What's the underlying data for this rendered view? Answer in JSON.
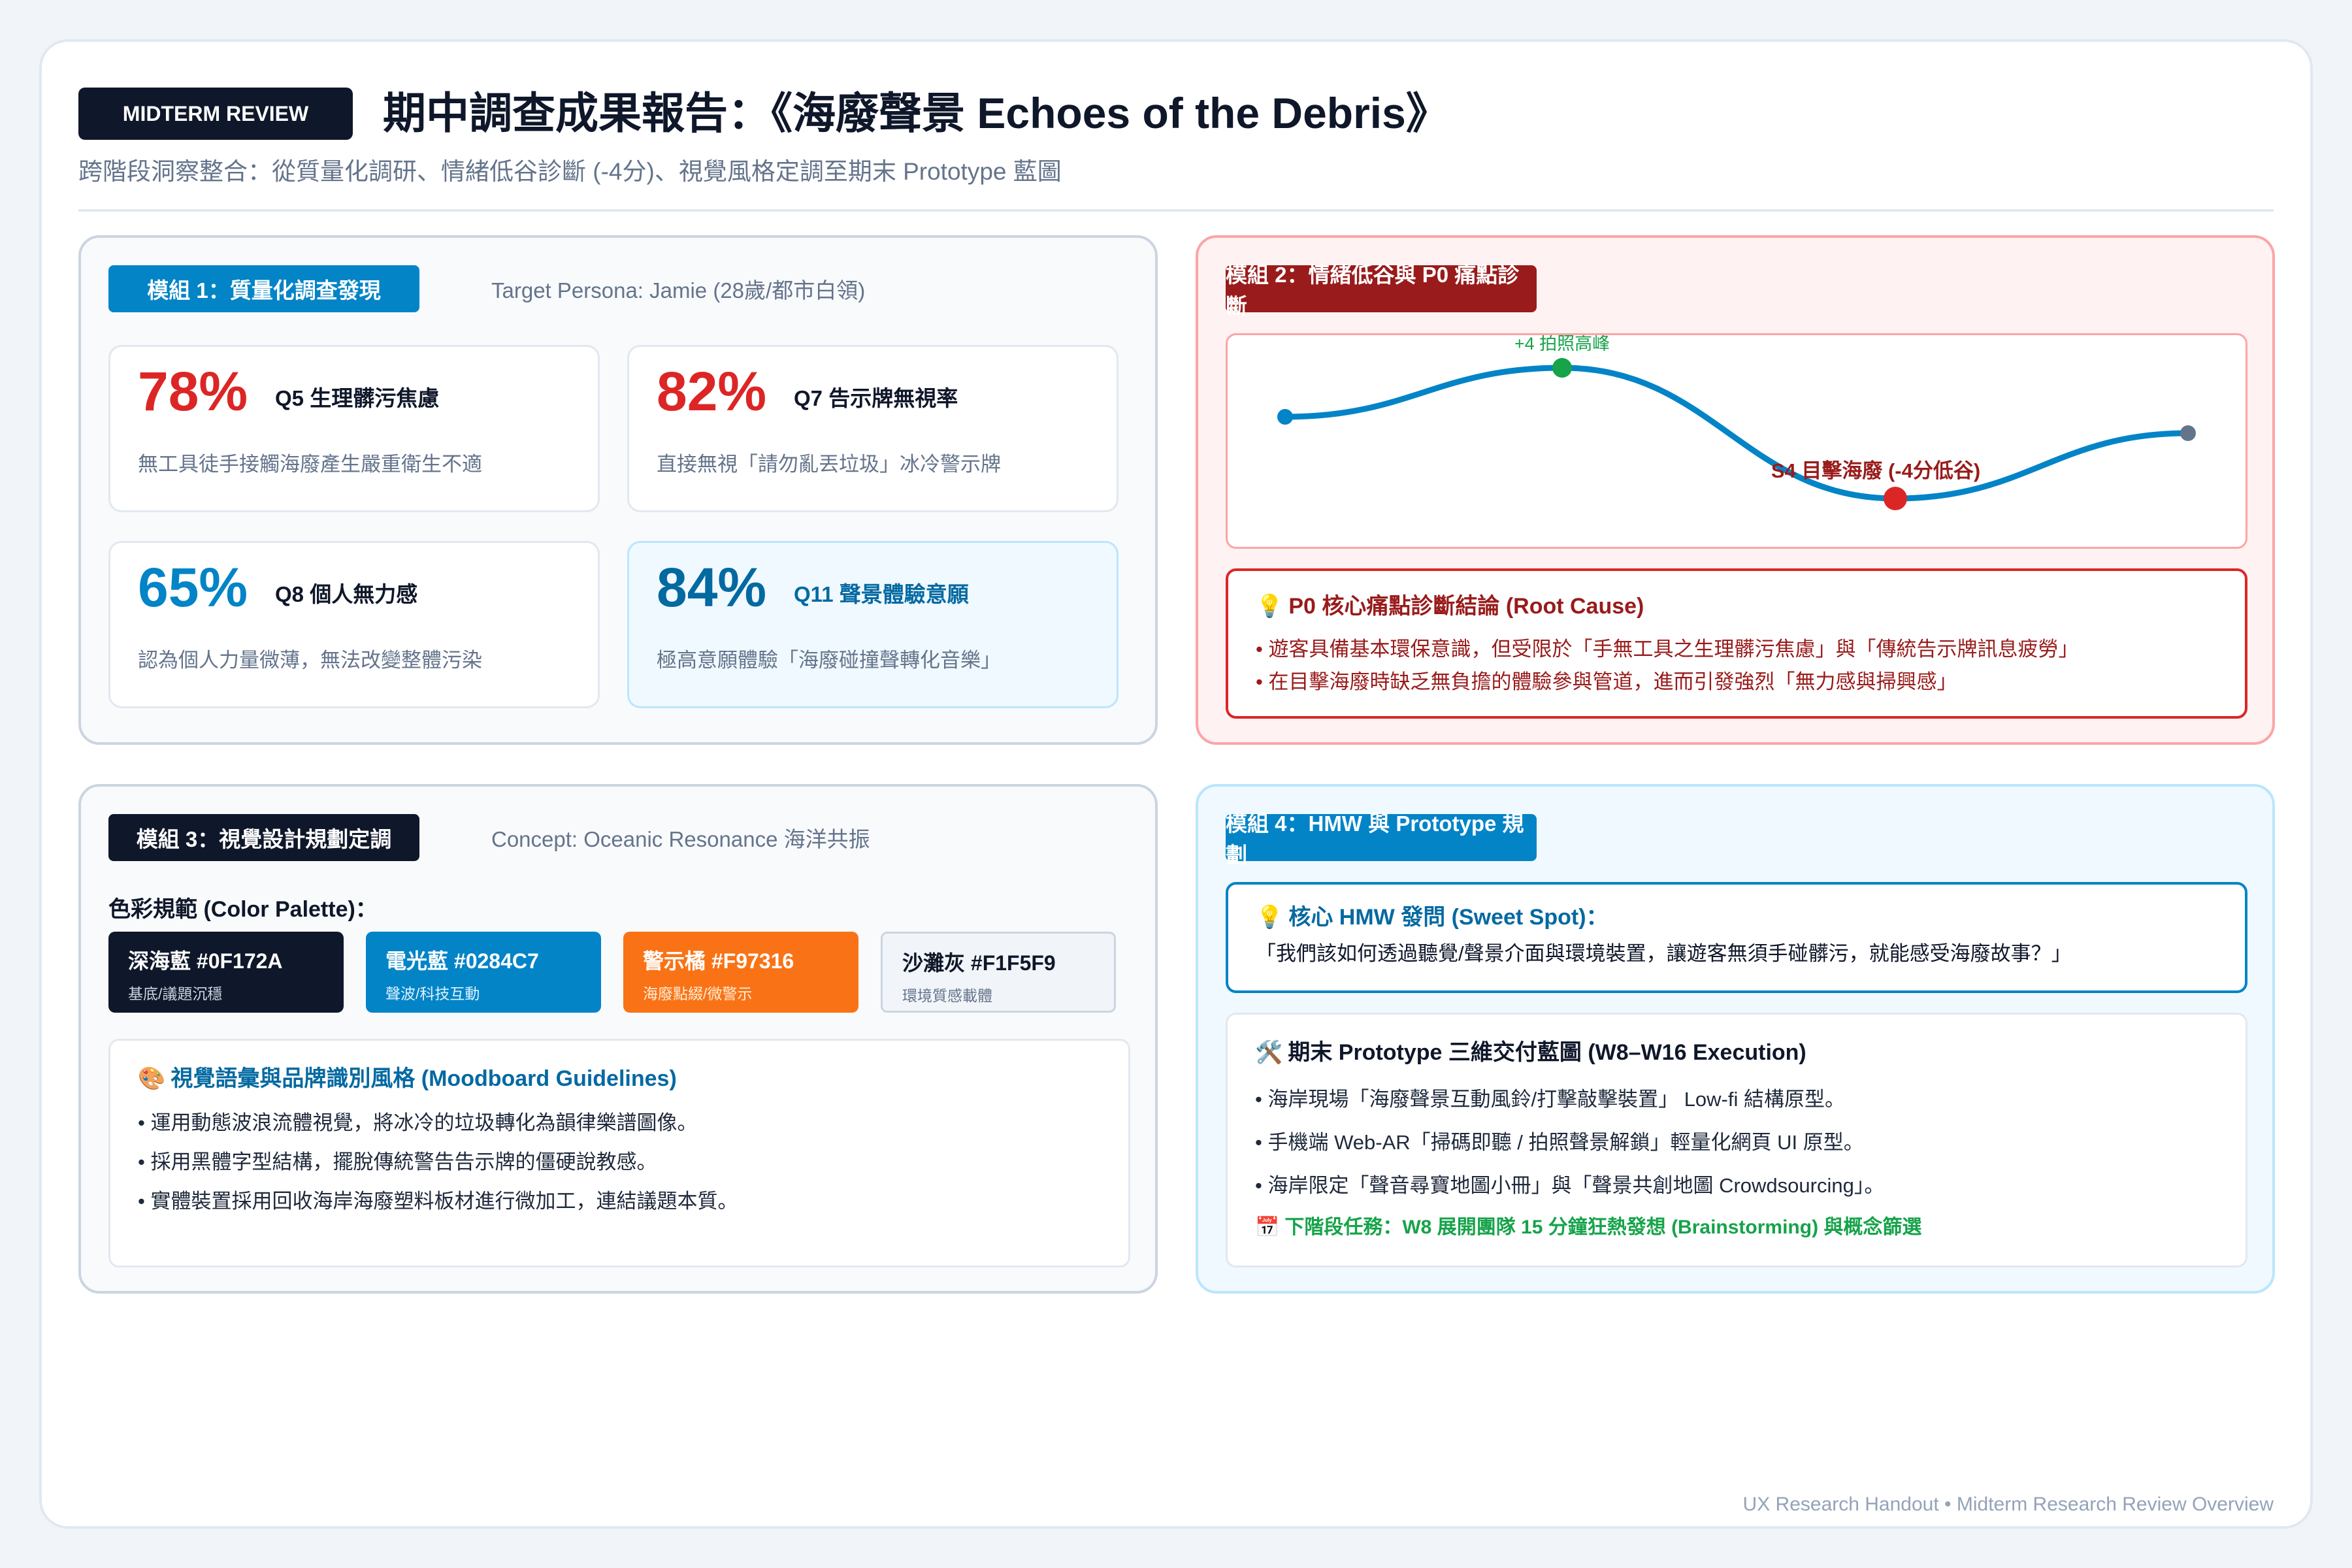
{
  "header": {
    "badge": "MIDTERM REVIEW",
    "title": "期中調查成果報告：《海廢聲景 Echoes of the Debris》",
    "subtitle": "跨階段洞察整合：從質量化調研、情緒低谷診斷 (-4分)、視覺風格定調至期末 Prototype 藍圖"
  },
  "module1": {
    "badge": "模組 1：質量化調查發現",
    "subtitle": "Target Persona: Jamie (28歲/都市白領)",
    "stats": [
      {
        "value": "78%",
        "label": "Q5 生理髒污焦慮",
        "desc": "無工具徒手接觸海廢產生嚴重衛生不適"
      },
      {
        "value": "82%",
        "label": "Q7 告示牌無視率",
        "desc": "直接無視「請勿亂丟垃圾」冰冷警示牌"
      },
      {
        "value": "65%",
        "label": "Q8 個人無力感",
        "desc": "認為個人力量微薄，無法改變整體污染"
      },
      {
        "value": "84%",
        "label": "Q11 聲景體驗意願",
        "desc": "極高意願體驗「海廢碰撞聲轉化音樂」"
      }
    ]
  },
  "module2": {
    "badge": "模組 2：情緒低谷與 P0 痛點診斷",
    "chart_data": {
      "type": "line",
      "points": [
        {
          "stage": 1,
          "score": 1
        },
        {
          "stage": 2,
          "score": 4
        },
        {
          "stage": 3,
          "score": -4
        },
        {
          "stage": 4,
          "score": 0
        }
      ],
      "annotations": {
        "peak": "+4 拍照高峰",
        "low": "S4 目擊海廢 (-4分低谷)"
      }
    },
    "root_title": "P0 核心痛點診斷結論 (Root Cause)",
    "root_bullets": [
      "• 遊客具備基本環保意識，但受限於「手無工具之生理髒污焦慮」與「傳統告示牌訊息疲勞」",
      "• 在目擊海廢時缺乏無負擔的體驗參與管道，進而引發強烈「無力感與掃興感」"
    ]
  },
  "module3": {
    "badge": "模組 3：視覺設計規劃定調",
    "subtitle": "Concept: Oceanic Resonance 海洋共振",
    "palette_title": "色彩規範 (Color Palette)：",
    "swatches": [
      {
        "name": "深海藍 #0F172A",
        "desc": "基底/議題沉穩",
        "color": "#0F172A"
      },
      {
        "name": "電光藍 #0284C7",
        "desc": "聲波/科技互動",
        "color": "#0284C7"
      },
      {
        "name": "警示橘 #F97316",
        "desc": "海廢點綴/微警示",
        "color": "#F97316"
      },
      {
        "name": "沙灘灰 #F1F5F9",
        "desc": "環境質感載體",
        "color": "#F1F5F9"
      }
    ],
    "mood_title": "視覺語彙與品牌識別風格 (Moodboard Guidelines)",
    "mood_bullets": [
      "• 運用動態波浪流體視覺，將冰冷的垃圾轉化為韻律樂譜圖像。",
      "• 採用黑體字型結構，擺脫傳統警告告示牌的僵硬說教感。",
      "• 實體裝置採用回收海岸海廢塑料板材進行微加工，連結議題本質。"
    ]
  },
  "module4": {
    "badge": "模組 4：HMW 與 Prototype 規劃",
    "hmw_title": "核心 HMW 發問 (Sweet Spot)：",
    "hmw_quote": "「我們該如何透過聽覺/聲景介面與環境裝置，讓遊客無須手碰髒污，就能感受海廢故事？」",
    "proto_title": "期末 Prototype 三維交付藍圖 (W8–W16 Execution)",
    "proto_bullets": [
      "• 海岸現場「海廢聲景互動風鈴/打擊敲擊裝置」 Low-fi 結構原型。",
      "• 手機端 Web-AR「掃碼即聽 / 拍照聲景解鎖」輕量化網頁 UI 原型。",
      "• 海岸限定「聲音尋寶地圖小冊」與「聲景共創地圖 Crowdsourcing」。"
    ],
    "next_task": "下階段任務：W8 展開團隊 15 分鐘狂熱發想 (Brainstorming) 與概念篩選"
  },
  "footer": "UX Research Handout • Midterm Research Review Overview"
}
